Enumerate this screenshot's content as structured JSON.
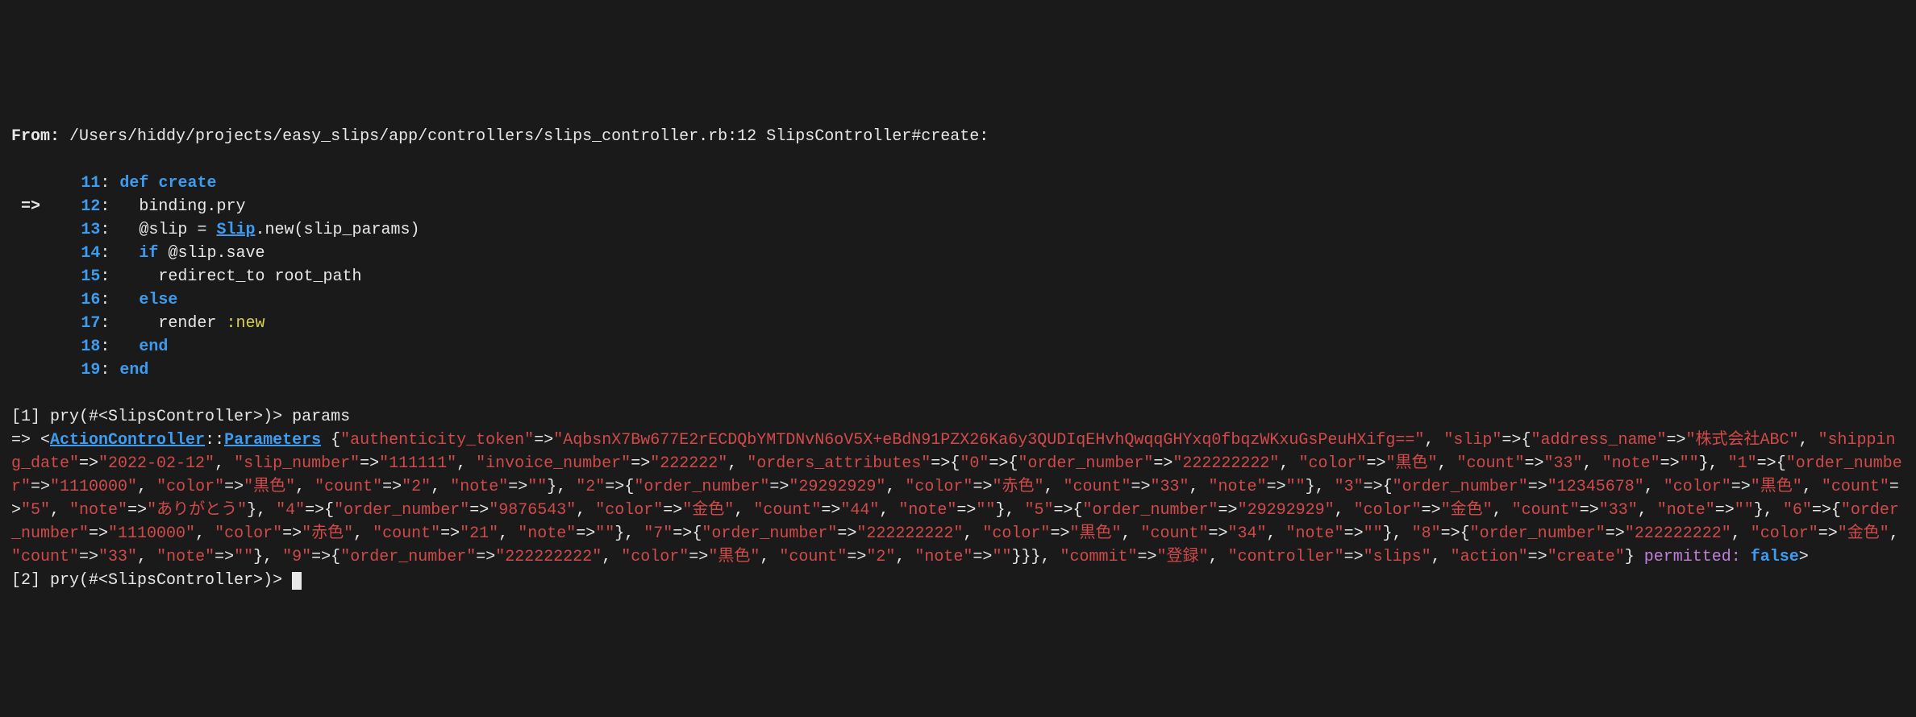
{
  "header": {
    "from_label": "From:",
    "file_path": "/Users/hiddy/projects/easy_slips/app/controllers/slips_controller.rb:12",
    "method": "SlipsController#create:"
  },
  "source": {
    "arrow": "=>",
    "lines": [
      {
        "num": "11",
        "def": "def",
        "name": "create"
      },
      {
        "num": "12",
        "code": "binding.pry"
      },
      {
        "num": "13",
        "at": "@slip",
        "eq": " = ",
        "cls": "Slip",
        "rest": ".new(slip_params)"
      },
      {
        "num": "14",
        "kw": "if",
        "rest": " @slip.save"
      },
      {
        "num": "15",
        "rest": "redirect_to root_path"
      },
      {
        "num": "16",
        "kw": "else"
      },
      {
        "num": "17",
        "rest1": "render ",
        "sym": ":new"
      },
      {
        "num": "18",
        "kw": "end"
      },
      {
        "num": "19",
        "kw": "end"
      }
    ]
  },
  "pry1": {
    "prompt_open": "[1] pry(",
    "prompt_mid": "#<SlipsController>",
    "prompt_close": ")> ",
    "input": "params"
  },
  "result": {
    "arrow": "=> ",
    "lt": "<",
    "class": "ActionController",
    "sep": "::",
    "subclass": "Parameters",
    "space": " ",
    "open": "{",
    "k_auth": "\"authenticity_token\"",
    "arw": "=>",
    "v_auth": "\"AqbsnX7Bw677E2rECDQbYMTDNvN6oV5X+eBdN91PZX26Ka6y3QUDIqEHvhQwqqGHYxq0fbqzWKxuGsPeuHXifg==\"",
    "c": ", ",
    "k_slip": "\"slip\"",
    "slip_open": "{",
    "k_addr": "\"address_name\"",
    "v_addr": "\"株式会社ABC\"",
    "k_ship": "\"shipping_date\"",
    "v_ship": "\"2022-02-12\"",
    "k_snum": "\"slip_number\"",
    "v_snum": "\"111111\"",
    "k_inv": "\"invoice_number\"",
    "v_inv": "\"222222\"",
    "k_oattr": "\"orders_attributes\"",
    "oattr_open": "{",
    "idx0": "\"0\"",
    "idx1": "\"1\"",
    "idx2": "\"2\"",
    "idx3": "\"3\"",
    "idx4": "\"4\"",
    "idx5": "\"5\"",
    "idx6": "\"6\"",
    "idx7": "\"7\"",
    "idx8": "\"8\"",
    "idx9": "\"9\"",
    "k_on": "\"order_number\"",
    "k_col": "\"color\"",
    "k_cnt": "\"count\"",
    "k_note": "\"note\"",
    "orders": [
      {
        "on": "\"222222222\"",
        "col": "\"黒色\"",
        "cnt": "\"33\"",
        "note": "\"\""
      },
      {
        "on": "\"1110000\"",
        "col": "\"黒色\"",
        "cnt": "\"2\"",
        "note": "\"\""
      },
      {
        "on": "\"29292929\"",
        "col": "\"赤色\"",
        "cnt": "\"33\"",
        "note": "\"\""
      },
      {
        "on": "\"12345678\"",
        "col": "\"黒色\"",
        "cnt": "\"5\"",
        "note": "\"ありがとう\""
      },
      {
        "on": "\"9876543\"",
        "col": "\"金色\"",
        "cnt": "\"44\"",
        "note": "\"\""
      },
      {
        "on": "\"29292929\"",
        "col": "\"金色\"",
        "cnt": "\"33\"",
        "note": "\"\""
      },
      {
        "on": "\"1110000\"",
        "col": "\"赤色\"",
        "cnt": "\"21\"",
        "note": "\"\""
      },
      {
        "on": "\"222222222\"",
        "col": "\"黒色\"",
        "cnt": "\"34\"",
        "note": "\"\""
      },
      {
        "on": "\"222222222\"",
        "col": "\"金色\"",
        "cnt": "\"33\"",
        "note": "\"\""
      },
      {
        "on": "\"222222222\"",
        "col": "\"黒色\"",
        "cnt": "\"2\"",
        "note": "\"\""
      }
    ],
    "close_orders": "}",
    "close_slip": "}",
    "k_commit": "\"commit\"",
    "v_commit": "\"登録\"",
    "k_ctrl": "\"controller\"",
    "v_ctrl": "\"slips\"",
    "k_act": "\"action\"",
    "v_act": "\"create\"",
    "close_params": "}",
    "permitted_label": "permitted: ",
    "permitted_val": "false",
    "gt": ">"
  },
  "pry2": {
    "prompt_open": "[2] pry(",
    "prompt_mid": "#<SlipsController>",
    "prompt_close": ")> "
  }
}
